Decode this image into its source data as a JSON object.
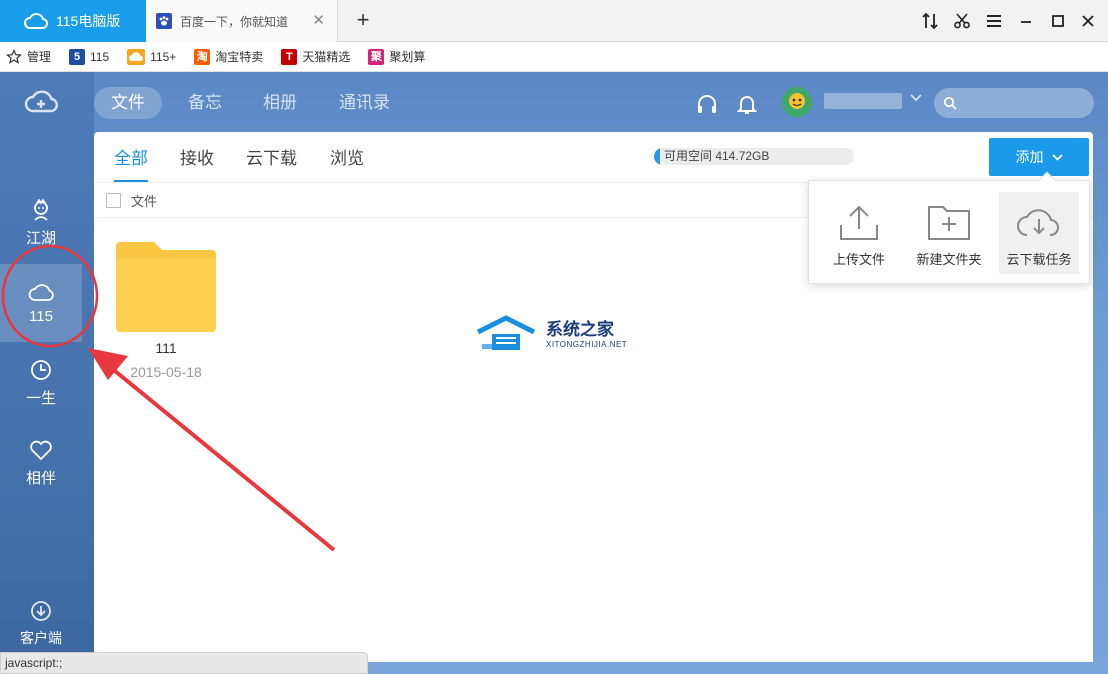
{
  "browser": {
    "active_tab": "115电脑版",
    "inactive_tab": "百度一下，你就知道",
    "new_tab_glyph": "+",
    "close_glyph": "✕"
  },
  "bookmarks": [
    {
      "label": "管理",
      "icon": "star-icon"
    },
    {
      "label": "115",
      "icon": "115-icon",
      "badge": "5",
      "color": "#1f4fa3"
    },
    {
      "label": "115+",
      "icon": "cloud-icon",
      "color": "#f5a623"
    },
    {
      "label": "淘宝特卖",
      "icon": "taobao-icon",
      "badge": "淘",
      "color": "#ff5a00"
    },
    {
      "label": "天猫精选",
      "icon": "tmall-icon",
      "badge": "T",
      "color": "#c40000"
    },
    {
      "label": "聚划算",
      "icon": "juhuasuan-icon",
      "badge": "聚",
      "color": "#d4237a"
    }
  ],
  "rail": {
    "items": [
      {
        "label": "江湖",
        "icon": "jianghu-icon"
      },
      {
        "label": "115",
        "icon": "cloud-icon"
      },
      {
        "label": "一生",
        "icon": "clock-icon"
      },
      {
        "label": "相伴",
        "icon": "heart-icon"
      }
    ],
    "client_label": "客户端"
  },
  "nav": {
    "tabs": [
      "文件",
      "备忘",
      "相册",
      "通讯录"
    ]
  },
  "panel": {
    "sub_tabs": [
      "全部",
      "接收",
      "云下载",
      "浏览"
    ],
    "space_label": "可用空间 414.72GB",
    "space_used_fraction": 0.03,
    "add_button": "添加",
    "list_header": "文件",
    "folder": {
      "name": "111",
      "date": "2015-05-18"
    }
  },
  "add_menu": {
    "options": [
      "上传文件",
      "新建文件夹",
      "云下载任务"
    ]
  },
  "watermark": {
    "cn": "系统之家",
    "en": "XITONGZHIJIA.NET"
  },
  "status_text": "javascript:;",
  "colors": {
    "accent": "#1a9de8",
    "annotation": "#e8383d",
    "folder": "#fcc844"
  }
}
